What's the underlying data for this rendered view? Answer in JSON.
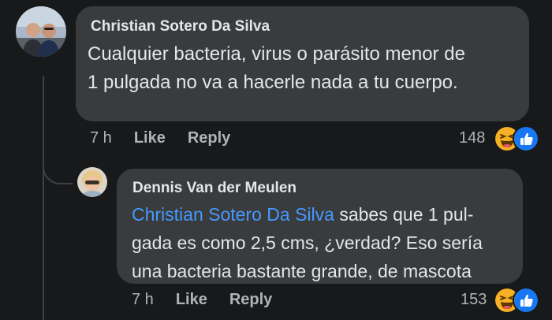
{
  "comments": [
    {
      "author": "Christian Sotero Da Silva",
      "text_line1": "Cualquier bacteria, virus o parásito menor de",
      "text_line2": "1 pulgada no va a hacerle nada a tu cuerpo.",
      "time": "7 h",
      "like_label": "Like",
      "reply_label": "Reply",
      "reaction_count": "148",
      "reactions": [
        "haha-icon",
        "like-icon"
      ]
    },
    {
      "author": "Dennis Van der Meulen",
      "mention": "Christian Sotero Da Silva",
      "text_line1_rest": " sabes que 1 pul-",
      "text_line2": "gada es como 2,5 cms, ¿verdad? Eso sería",
      "text_line3": "una bacteria bastante grande, de mascota",
      "time": "7 h",
      "like_label": "Like",
      "reply_label": "Reply",
      "reaction_count": "153",
      "reactions": [
        "haha-icon",
        "like-icon"
      ]
    }
  ],
  "colors": {
    "background": "#18191a",
    "bubble": "#3a3b3c",
    "text": "#e4e6eb",
    "secondary_text": "#b0b3b8",
    "mention": "#4599ff",
    "like_blue": "#1877f2",
    "haha_yellow": "#f7b125"
  }
}
